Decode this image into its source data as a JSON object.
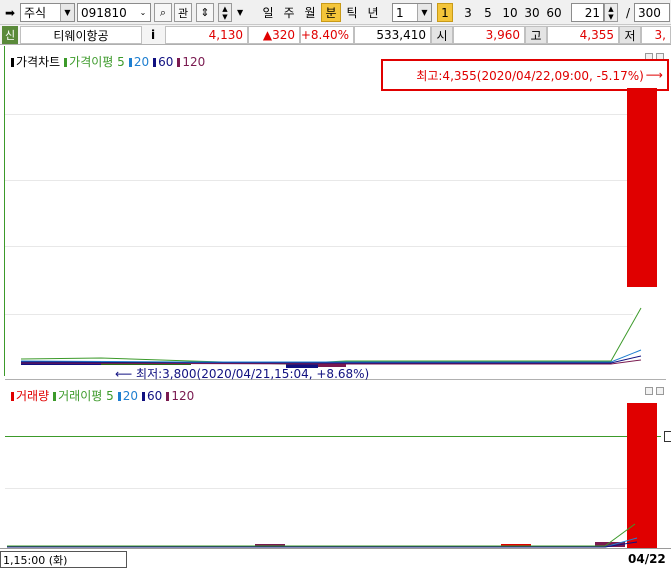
{
  "toolbar": {
    "market_select": "주식",
    "code_value": "091810",
    "period_labels": [
      "일",
      "주",
      "월",
      "분",
      "틱",
      "년"
    ],
    "active_period": "분",
    "interval_value": "1",
    "interval_active": "1",
    "interval_quick": [
      "3",
      "5",
      "10",
      "30",
      "60"
    ],
    "view_btn": "관",
    "count_current": "21",
    "count_separator": "/",
    "count_total": "300"
  },
  "quote": {
    "badge": "신",
    "name": "티웨이항공",
    "info": "i",
    "price": "4,130",
    "change": "▲320",
    "change_pct": "+8.40%",
    "volume": "533,410",
    "open_label": "시",
    "open_value": "3,960",
    "high_label": "고",
    "high_value": "4,355",
    "low_label": "저",
    "low_value": "3,"
  },
  "price_chart": {
    "legend_title": "가격차트",
    "ma_title": "가격이평",
    "ma_periods": [
      "5",
      "20",
      "60",
      "120"
    ],
    "high_annotation": "최고:4,355(2020/04/22,09:00, -5.17%)",
    "high_arrow": "⟶",
    "low_annotation": "최저:3,800(2020/04/21,15:04, +8.68%)",
    "low_arrow": "⟵"
  },
  "volume_chart": {
    "legend_title": "거래량",
    "ma_title": "거래이평",
    "ma_periods": [
      "5",
      "20",
      "60",
      "120"
    ]
  },
  "footer": {
    "time_label": "1,15:00 (화)",
    "date_label": "04/22"
  },
  "colors": {
    "up": "#e00000",
    "ma5": "#3c9a2a",
    "ma20": "#1f7fd0",
    "ma60": "#101080",
    "ma120": "#7a1a50",
    "highlight": "#f4c53a"
  }
}
